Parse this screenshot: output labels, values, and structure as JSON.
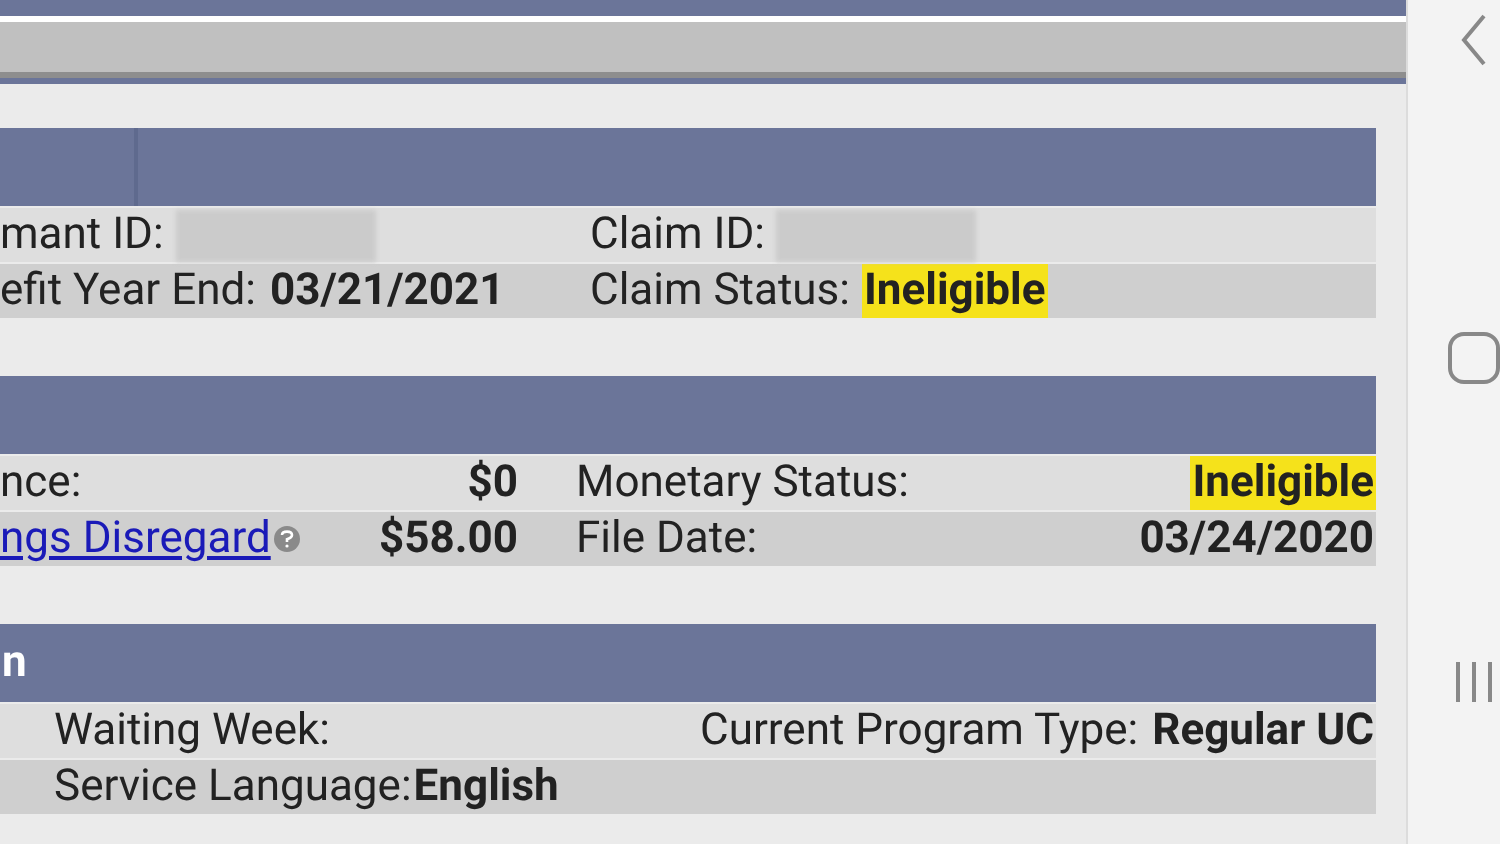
{
  "sections": [
    {
      "kind": "claim",
      "rows": [
        {
          "cells": [
            {
              "kind": "inline",
              "label": {
                "kind": "plain",
                "text": "mant ID:"
              },
              "value": {
                "kind": "blurred"
              }
            },
            {
              "kind": "inline",
              "label": {
                "kind": "plain",
                "text": "Claim ID:"
              },
              "value": {
                "kind": "blurred"
              }
            }
          ]
        },
        {
          "cells": [
            {
              "kind": "inline",
              "label": {
                "kind": "plain",
                "text": "efit Year End:"
              },
              "value": {
                "kind": "text",
                "text": "03/21/2021",
                "highlighted": false
              }
            },
            {
              "kind": "inline",
              "label": {
                "kind": "plain",
                "text": "Claim Status:"
              },
              "value": {
                "kind": "text",
                "text": "Ineligible",
                "highlighted": true
              }
            }
          ]
        }
      ]
    },
    {
      "kind": "monetary",
      "rows": [
        {
          "cells": [
            {
              "kind": "apart",
              "label": {
                "kind": "plain",
                "text": "nce:"
              },
              "value": {
                "kind": "text",
                "text": "$0",
                "highlighted": false
              }
            },
            {
              "kind": "apart",
              "label": {
                "kind": "plain",
                "text": "Monetary Status:"
              },
              "value": {
                "kind": "text",
                "text": "Ineligible",
                "highlighted": true
              }
            }
          ]
        },
        {
          "cells": [
            {
              "kind": "apart",
              "label": {
                "kind": "link",
                "text": "ngs Disregard"
              },
              "value": {
                "kind": "text",
                "text": "$58.00",
                "highlighted": false
              }
            },
            {
              "kind": "apart",
              "label": {
                "kind": "plain",
                "text": "File Date:"
              },
              "value": {
                "kind": "text",
                "text": "03/24/2020",
                "highlighted": false
              }
            }
          ]
        }
      ]
    },
    {
      "kind": "program",
      "header": "n",
      "rows": [
        {
          "cells": [
            {
              "kind": "inline",
              "label": {
                "kind": "plain",
                "text": "Waiting Week:"
              }
            },
            {
              "kind": "right",
              "label": {
                "kind": "plain",
                "text": "Current Program Type:"
              },
              "value": {
                "kind": "text",
                "text": "Regular UC",
                "highlighted": false
              }
            }
          ]
        },
        {
          "cells": [
            {
              "kind": "tight",
              "label": {
                "kind": "plain",
                "text": "Service Language:"
              },
              "value": {
                "kind": "text",
                "text": "English",
                "highlighted": false
              }
            }
          ]
        }
      ]
    }
  ]
}
